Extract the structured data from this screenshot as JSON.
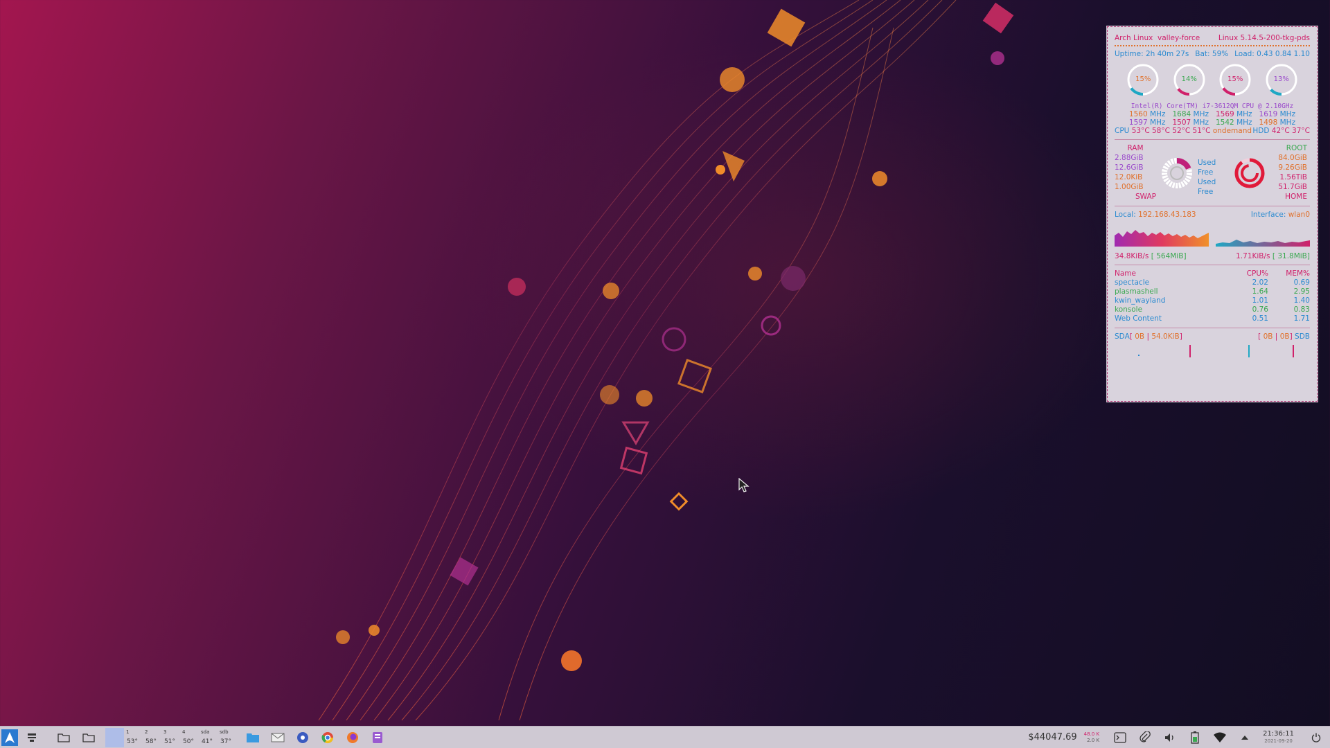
{
  "conky": {
    "distro": "Arch Linux",
    "hostname": "valley-force",
    "kernel": "Linux 5.14.5-200-tkg-pds",
    "uptime": "Uptime: 2h 40m 27s",
    "battery": "Bat: 59%",
    "load": "Load: 0.43 0.84 1.10",
    "cores": [
      {
        "label": "15%",
        "value": 15,
        "color": "#1fa8c4"
      },
      {
        "label": "14%",
        "value": 14,
        "color": "#d0206a"
      },
      {
        "label": "15%",
        "value": 15,
        "color": "#d0206a"
      },
      {
        "label": "13%",
        "value": 13,
        "color": "#1fa8c4"
      }
    ],
    "cpu_model": "Intel(R) Core(TM) i7-3612QM CPU @ 2.10GHz",
    "freq_row1": [
      {
        "v": "1560",
        "u": "MHz",
        "color": "#e0702a"
      },
      {
        "v": "1684",
        "u": "MHz",
        "color": "#3aa850"
      },
      {
        "v": "1569",
        "u": "MHz",
        "color": "#d0206a"
      },
      {
        "v": "1619",
        "u": "MHz",
        "color": "#9a4acb"
      }
    ],
    "freq_row2": [
      {
        "v": "1597",
        "u": "MHz",
        "color": "#9a4acb"
      },
      {
        "v": "1507",
        "u": "MHz",
        "color": "#d0206a"
      },
      {
        "v": "1542",
        "u": "MHz",
        "color": "#3aa850"
      },
      {
        "v": "1498",
        "u": "MHz",
        "color": "#e0702a"
      }
    ],
    "temps_label": "CPU",
    "temps": "53°C 58°C 52°C 51°C",
    "governor": "ondemand",
    "hdd_label": "HDD",
    "hdd_temps": "42°C 37°C",
    "ram_label": "RAM",
    "swap_label": "SWAP",
    "root_label": "ROOT",
    "home_label": "HOME",
    "ram_values": [
      "2.88GiB",
      "12.6GiB",
      "12.0KiB",
      "1.00GiB"
    ],
    "mem_states": [
      "Used",
      "Free",
      "Used",
      "Free"
    ],
    "disk_values": [
      "84.0GiB",
      "9.26GiB",
      "1.56TiB",
      "51.7GiB"
    ],
    "ram_used_fraction": 0.19,
    "root_used_fraction": 0.9,
    "local_ip_label": "Local:",
    "local_ip": "192.168.43.183",
    "interface_label": "Interface:",
    "interface": "wlan0",
    "down_rate": "34.8KiB/s",
    "down_total": "564MiB",
    "up_rate": "1.71KiB/s",
    "up_total": "31.8MiB",
    "proc_headers": [
      "Name",
      "CPU%",
      "MEM%"
    ],
    "processes": [
      {
        "name": "spectacle",
        "cpu": "2.02",
        "mem": "0.69",
        "color": "#2a8ad0"
      },
      {
        "name": "plasmashell",
        "cpu": "1.64",
        "mem": "2.95",
        "color": "#3aa850"
      },
      {
        "name": "kwin_wayland",
        "cpu": "1.01",
        "mem": "1.40",
        "color": "#2a8ad0"
      },
      {
        "name": "konsole",
        "cpu": "0.76",
        "mem": "0.83",
        "color": "#3aa850"
      },
      {
        "name": "Web Content",
        "cpu": "0.51",
        "mem": "1.71",
        "color": "#2a8ad0"
      }
    ],
    "sda_label": "SDA",
    "sda_read": "0B",
    "sda_write": "54.0KiB",
    "sdb_label": "SDB",
    "sdb_read": "0B",
    "sdb_write": "0B"
  },
  "taskbar": {
    "desktops": [
      {
        "n": "",
        "temp": ""
      },
      {
        "n": "1",
        "temp": "53°"
      },
      {
        "n": "2",
        "temp": "58°"
      },
      {
        "n": "3",
        "temp": "51°"
      },
      {
        "n": "4",
        "temp": "50°"
      },
      {
        "n": "sda",
        "temp": "41°"
      },
      {
        "n": "sdb",
        "temp": "37°"
      }
    ],
    "price": "$44047.69",
    "net_up": "48.0 K",
    "net_down": "2.0 K",
    "time": "21:36:11",
    "date": "2021-09-20",
    "icons": {
      "launcher": "arch-launcher-icon",
      "tray": [
        "terminal-icon",
        "clip-icon",
        "volume-icon",
        "battery-icon",
        "wifi-icon",
        "expand-arrow-icon"
      ]
    }
  },
  "colors": {
    "accent_pink": "#d0206a",
    "accent_orange": "#e0702a",
    "accent_blue": "#2a8ad0",
    "accent_green": "#3aa850"
  }
}
